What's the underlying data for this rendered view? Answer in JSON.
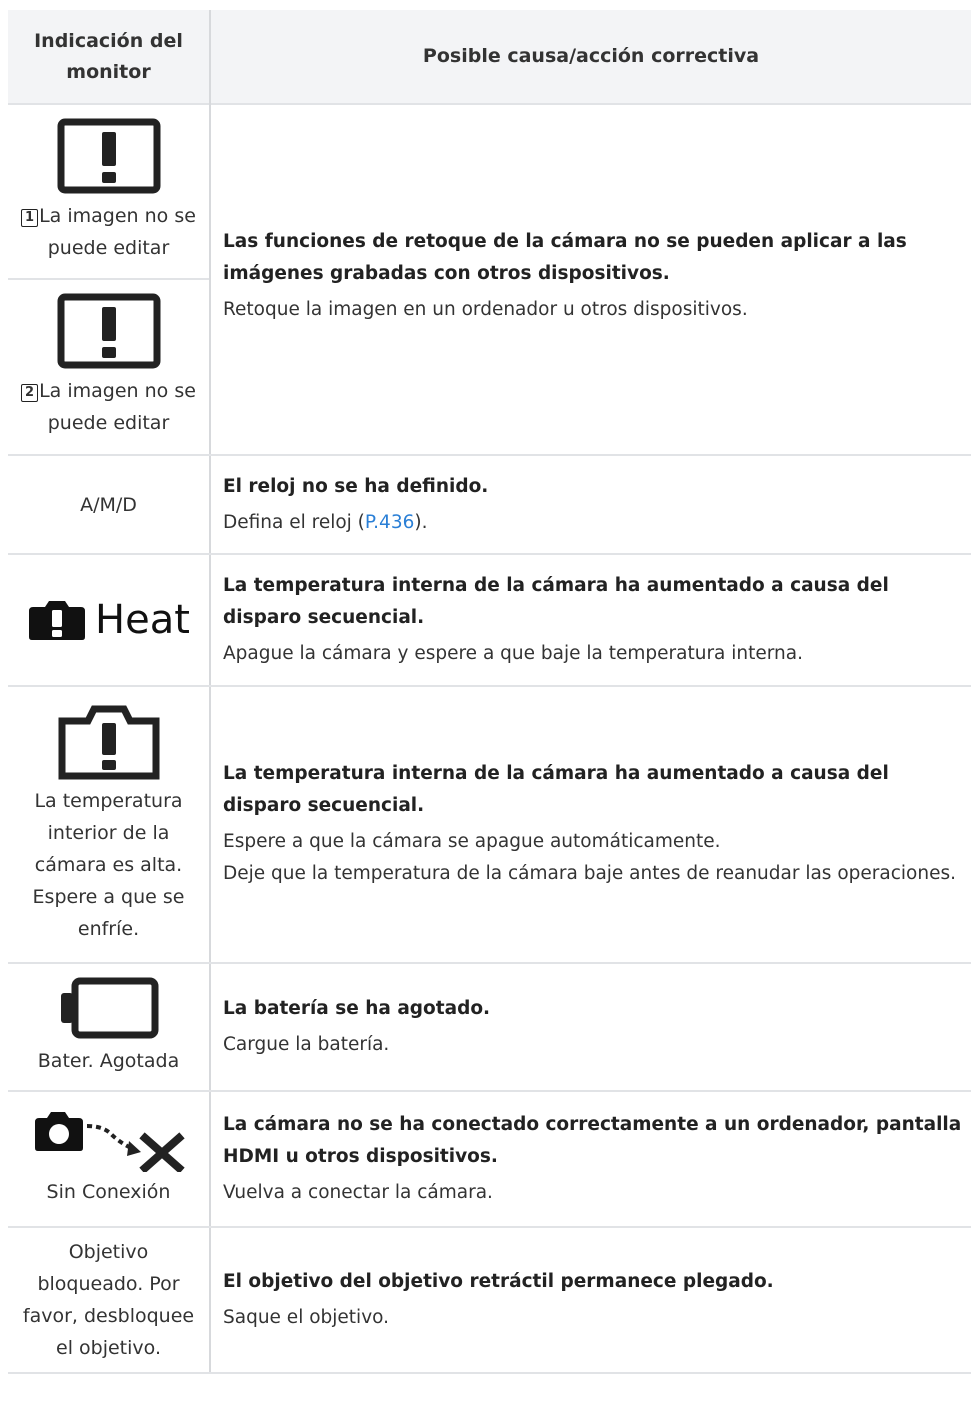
{
  "header": {
    "col1": "Indicación del monitor",
    "col2": "Posible causa/acción correctiva"
  },
  "rows": [
    {
      "indications": [
        {
          "icon": "warning-box-icon",
          "badge": "1",
          "label": "La imagen no se puede editar"
        },
        {
          "icon": "warning-box-icon",
          "badge": "2",
          "label": "La imagen no se puede editar"
        }
      ],
      "cause": "Las funciones de retoque de la cámara no se pueden aplicar a las imágenes grabadas con otros dispositivos.",
      "actions": [
        "Retoque la imagen en un ordenador u otros dispositivos."
      ]
    },
    {
      "indication": "A/M/D",
      "cause": "El reloj no se ha definido.",
      "action_prefix": "Defina el reloj (",
      "action_link": "P.436",
      "action_suffix": ")."
    },
    {
      "indication_icon": "camera-warning-filled-icon",
      "indication_text": "Heat",
      "cause": "La temperatura interna de la cámara ha aumentado a causa del disparo secuencial.",
      "actions": [
        "Apague la cámara y espere a que baje la temperatura interna."
      ]
    },
    {
      "indication_icon": "camera-warning-outline-icon",
      "indication": "La temperatura interior de la cámara es alta. Espere a que se enfríe.",
      "cause": "La temperatura interna de la cámara ha aumentado a causa del disparo secuencial.",
      "actions": [
        "Espere a que la cámara se apague automáticamente.",
        "Deje que la temperatura de la cámara baje antes de reanudar las operaciones."
      ]
    },
    {
      "indication_icon": "battery-empty-icon",
      "indication": "Bater. Agotada",
      "cause": "La batería se ha agotado.",
      "actions": [
        "Cargue la batería."
      ]
    },
    {
      "indication_icon": "camera-no-connection-icon",
      "indication": "Sin Conexión",
      "cause": "La cámara no se ha conectado correctamente a un ordenador, pantalla HDMI u otros dispositivos.",
      "actions": [
        "Vuelva a conectar la cámara."
      ]
    },
    {
      "indication": "Objetivo bloqueado. Por favor, desbloquee el objetivo.",
      "cause": "El objetivo del objetivo retráctil permanece plegado.",
      "actions": [
        "Saque el objetivo."
      ]
    }
  ],
  "colors": {
    "link": "#2a7fd6",
    "header_bg": "#f3f4f6",
    "rule": "#e1e3e6"
  }
}
